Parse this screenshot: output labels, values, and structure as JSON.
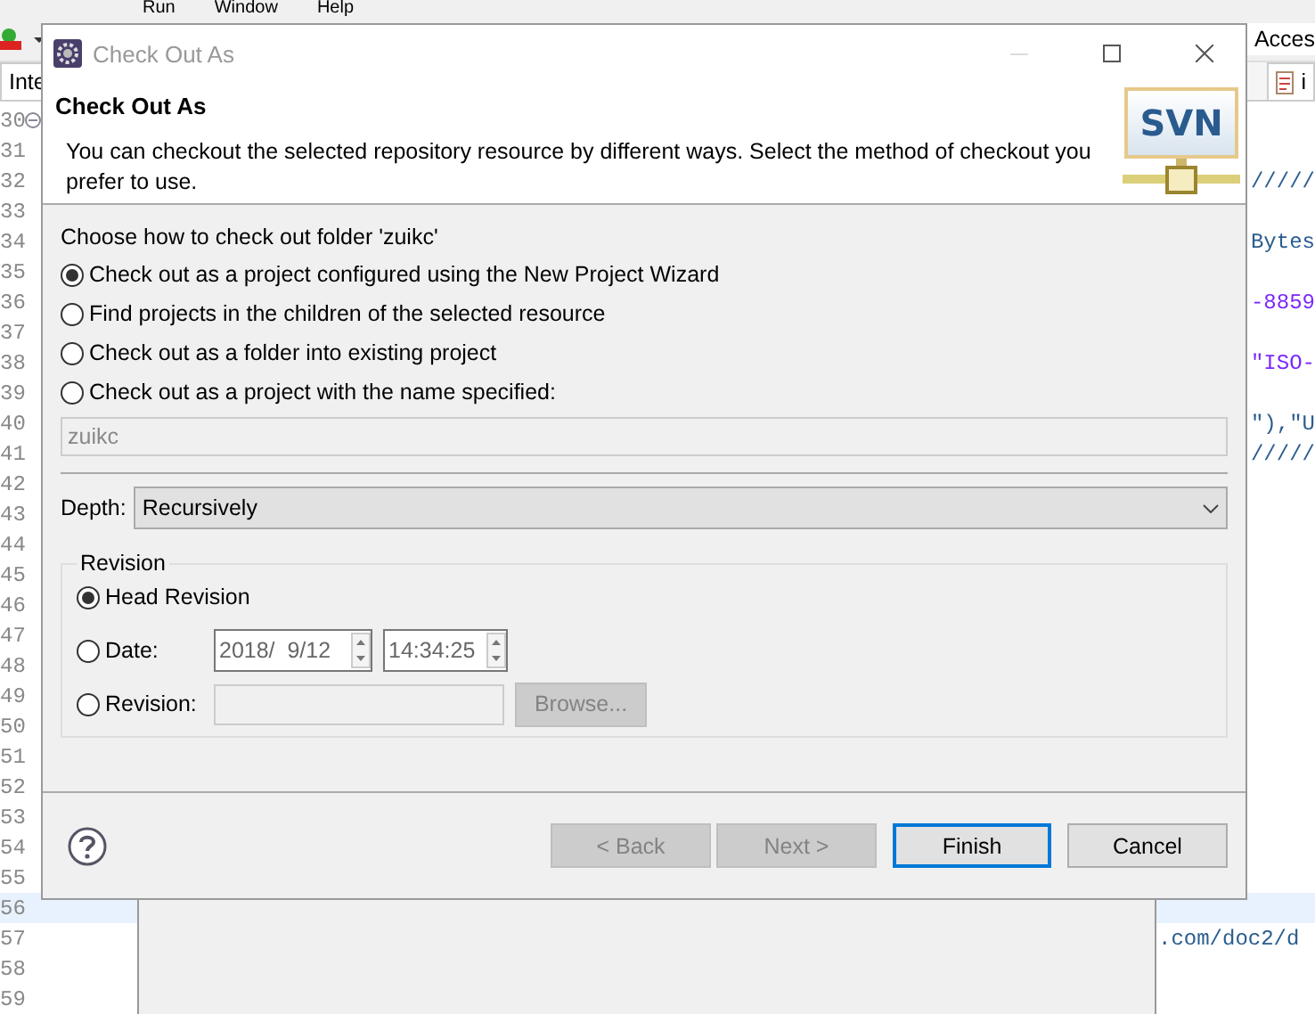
{
  "ide": {
    "menu": [
      "Run",
      "Window",
      "Help"
    ],
    "quick_access": "Acces",
    "left_tab": "Inte",
    "right_tab": "i",
    "rows": [
      {
        "number": "30",
        "code": "",
        "expanded": true,
        "highlighted": false
      },
      {
        "number": "31",
        "code": "",
        "highlighted": false
      },
      {
        "number": "32",
        "code": "/////",
        "highlighted": false
      },
      {
        "number": "33",
        "code": "",
        "highlighted": false
      },
      {
        "number": "34",
        "code": "Bytes",
        "highlighted": false
      },
      {
        "number": "35",
        "code": "",
        "highlighted": false
      },
      {
        "number": "36",
        "code": "-8859",
        "highlighted": false
      },
      {
        "number": "37",
        "code": "",
        "highlighted": false
      },
      {
        "number": "38",
        "code": "\"ISO-",
        "highlighted": false
      },
      {
        "number": "39",
        "code": "",
        "highlighted": false
      },
      {
        "number": "40",
        "code": "\"),\"U",
        "highlighted": false
      },
      {
        "number": "41",
        "code": "/////",
        "highlighted": false
      },
      {
        "number": "42",
        "code": "",
        "highlighted": false
      },
      {
        "number": "43",
        "code": "",
        "highlighted": false
      },
      {
        "number": "44",
        "code": "",
        "highlighted": false
      },
      {
        "number": "45",
        "code": "",
        "highlighted": false
      },
      {
        "number": "46",
        "code": "",
        "highlighted": false
      },
      {
        "number": "47",
        "code": "",
        "highlighted": false
      },
      {
        "number": "48",
        "code": "",
        "highlighted": false
      },
      {
        "number": "49",
        "code": "",
        "highlighted": false
      },
      {
        "number": "50",
        "code": "",
        "highlighted": false
      },
      {
        "number": "51",
        "code": "",
        "highlighted": false
      },
      {
        "number": "52",
        "code": "",
        "highlighted": false
      },
      {
        "number": "53",
        "code": "",
        "highlighted": false
      },
      {
        "number": "54",
        "code": "",
        "highlighted": false
      },
      {
        "number": "55",
        "code": "",
        "highlighted": false
      },
      {
        "number": "56",
        "code": "",
        "highlighted": true
      },
      {
        "number": "57",
        "code": ".com/doc2/d",
        "highlighted": false
      },
      {
        "number": "58",
        "code": "",
        "highlighted": false
      },
      {
        "number": "59",
        "code": "",
        "highlighted": false
      }
    ]
  },
  "dialog": {
    "title": "Check Out As",
    "heading": "Check Out As",
    "description": "You can checkout the selected repository resource by different ways. Select the method of checkout you prefer to use.",
    "logo_text": "SVN",
    "prompt": "Choose how to check out folder 'zuikc'",
    "methods": [
      {
        "label": "Check out as a project configured using the New Project Wizard",
        "selected": true
      },
      {
        "label": "Find projects in the children of the selected resource",
        "selected": false
      },
      {
        "label": "Check out as a folder into existing project",
        "selected": false
      },
      {
        "label": "Check out as a project with the name specified:",
        "selected": false
      }
    ],
    "project_name": {
      "value": "zuikc",
      "disabled": true
    },
    "depth": {
      "label": "Depth:",
      "value": "Recursively"
    },
    "revision": {
      "legend": "Revision",
      "options": [
        {
          "kind": "plain",
          "label": "Head Revision",
          "selected": true
        },
        {
          "kind": "date",
          "label": "Date:",
          "selected": false,
          "date": "2018/  9/12",
          "time": "14:34:25"
        },
        {
          "kind": "number",
          "label": "Revision:",
          "selected": false,
          "button": "Browse...",
          "button_disabled": true
        }
      ]
    },
    "buttons": [
      {
        "label": "< Back",
        "disabled": true,
        "default": false
      },
      {
        "label": "Next >",
        "disabled": true,
        "default": false
      },
      {
        "label": "Finish",
        "disabled": false,
        "default": true
      },
      {
        "label": "Cancel",
        "disabled": false,
        "default": false
      }
    ]
  }
}
